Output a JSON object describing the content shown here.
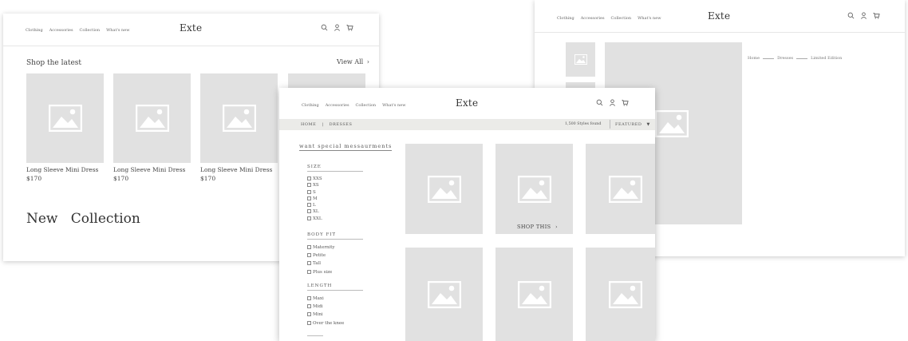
{
  "nav": [
    "Clothing",
    "Accessories",
    "Collection",
    "What's new"
  ],
  "brand": "Exte",
  "colors": {
    "placeholder": "#e1e1e1",
    "bar": "#ebebe8",
    "text": "#3a3a3a"
  },
  "icons": [
    "search-icon",
    "user-icon",
    "cart-icon"
  ],
  "home": {
    "section_title": "Shop the latest",
    "view_all": "View All",
    "products": [
      {
        "name": "Long Sleeve Mini Dress",
        "price": "$170"
      },
      {
        "name": "Long Sleeve Mini Dress",
        "price": "$170"
      },
      {
        "name": "Long Sleeve Mini Dress",
        "price": "$170"
      }
    ],
    "new_collection": "New   Collection"
  },
  "product_page": {
    "breadcrumb": [
      "Home",
      "Dresses",
      "Limited Edition"
    ]
  },
  "listing": {
    "breadcrumb_home": "HOME",
    "breadcrumb_sep": "|",
    "breadcrumb_current": "DRESSES",
    "styles_found": "1,500 Styles found",
    "sort_label": "FEATURED",
    "special_link": "want special messaurments",
    "shop_this": "SHOP THIS",
    "filters": [
      {
        "title": "SIZE",
        "options": [
          "XXS",
          "XS",
          "S",
          "M",
          "L",
          "XL",
          "XXL"
        ]
      },
      {
        "title": "BODY FIT",
        "options": [
          "Maternity",
          "Petite",
          "Tall",
          "Plus size"
        ]
      },
      {
        "title": "LENGTH",
        "options": [
          "Maxi",
          "Midi",
          "Mini",
          "Over the knee"
        ]
      }
    ]
  }
}
